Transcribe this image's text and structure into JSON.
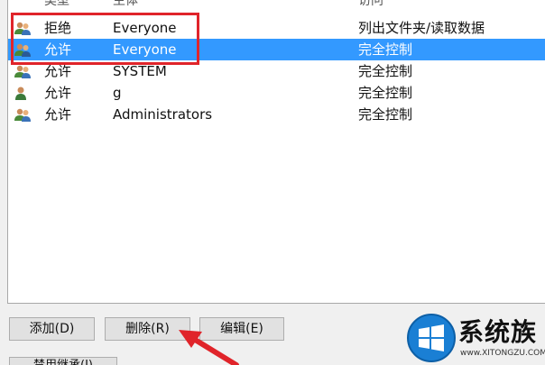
{
  "columns": {
    "type": "类型",
    "principal": "主体",
    "access": "访问"
  },
  "entries": [
    {
      "type": "拒绝",
      "principal": "Everyone",
      "access": "列出文件夹/读取数据",
      "icon": "users-group-icon",
      "selected": false
    },
    {
      "type": "允许",
      "principal": "Everyone",
      "access": "完全控制",
      "icon": "users-group-icon",
      "selected": true
    },
    {
      "type": "允许",
      "principal": "SYSTEM",
      "access": "完全控制",
      "icon": "users-group-icon",
      "selected": false
    },
    {
      "type": "允许",
      "principal": "g",
      "access": "完全控制",
      "icon": "user-icon",
      "selected": false
    },
    {
      "type": "允许",
      "principal": "Administrators",
      "access": "完全控制",
      "icon": "users-group-icon",
      "selected": false
    }
  ],
  "buttons": {
    "add": "添加(D)",
    "delete": "删除(R)",
    "edit": "编辑(E)",
    "partial": "禁用继承(I)"
  },
  "watermark": {
    "name": "系统族",
    "url": "www.XITONGZU.COM"
  },
  "colors": {
    "selection": "#3399ff",
    "annotation": "#e0242a"
  }
}
